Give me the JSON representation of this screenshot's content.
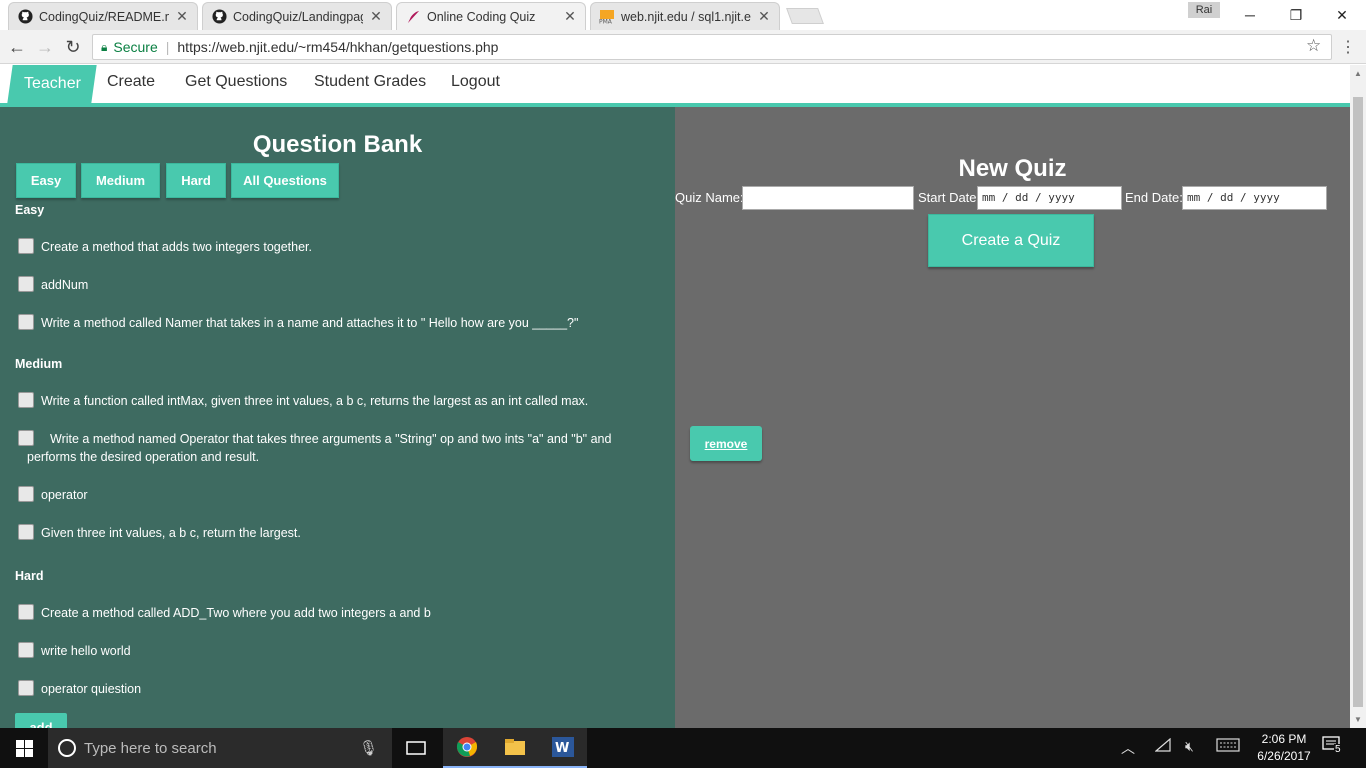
{
  "browser": {
    "tabs": [
      {
        "title": "CodingQuiz/README.mc",
        "icon": "github-icon"
      },
      {
        "title": "CodingQuiz/Landingpag",
        "icon": "github-icon"
      },
      {
        "title": "Online Coding Quiz",
        "icon": "feather-icon",
        "active": true
      },
      {
        "title": "web.njit.edu / sql1.njit.ed",
        "icon": "phpmyadmin-icon"
      }
    ],
    "profile_label": "Rai",
    "secure_label": "Secure",
    "url": "https://web.njit.edu/~rm454/hkhan/getquestions.php"
  },
  "site_nav": {
    "items": [
      "Teacher",
      "Create",
      "Get Questions",
      "Student Grades",
      "Logout"
    ],
    "active": "Teacher",
    "accent": "#49c9ae"
  },
  "question_bank": {
    "title": "Question Bank",
    "filters": [
      "Easy",
      "Medium",
      "Hard",
      "All Questions"
    ],
    "groups": [
      {
        "label": "Easy",
        "questions": [
          "Create a method that adds two integers together.",
          "addNum",
          "Write a method called Namer that takes in a name and attaches it to \" Hello how are you _____?\""
        ]
      },
      {
        "label": "Medium",
        "questions": [
          "Write a function called intMax, given three int values, a b c, returns the largest as an int called max.",
          "Write a method named Operator that takes three arguments a \"String\" op and two ints \"a\" and \"b\" and performs the desired operation and result.",
          "operator",
          "Given three int values, a b c, return the largest."
        ]
      },
      {
        "label": "Hard",
        "questions": [
          "Create a method called ADD_Two where you add two integers a and b",
          "write hello world",
          "operator quiestion"
        ]
      }
    ],
    "add_label": "add",
    "panel_color": "#3e6b61"
  },
  "new_quiz": {
    "title": "New Quiz",
    "quiz_name_label": "Quiz Name:",
    "quiz_name_value": "",
    "start_date_label": "Start Date:",
    "start_date_placeholder": "mm / dd / yyyy",
    "end_date_label": "End Date:",
    "end_date_placeholder": "mm / dd / yyyy",
    "create_label": "Create a Quiz",
    "remove_label": "remove",
    "panel_color": "#6b6b6b"
  },
  "taskbar": {
    "search_placeholder": "Type here to search",
    "time": "2:06 PM",
    "date": "6/26/2017",
    "notification_count": "5"
  }
}
